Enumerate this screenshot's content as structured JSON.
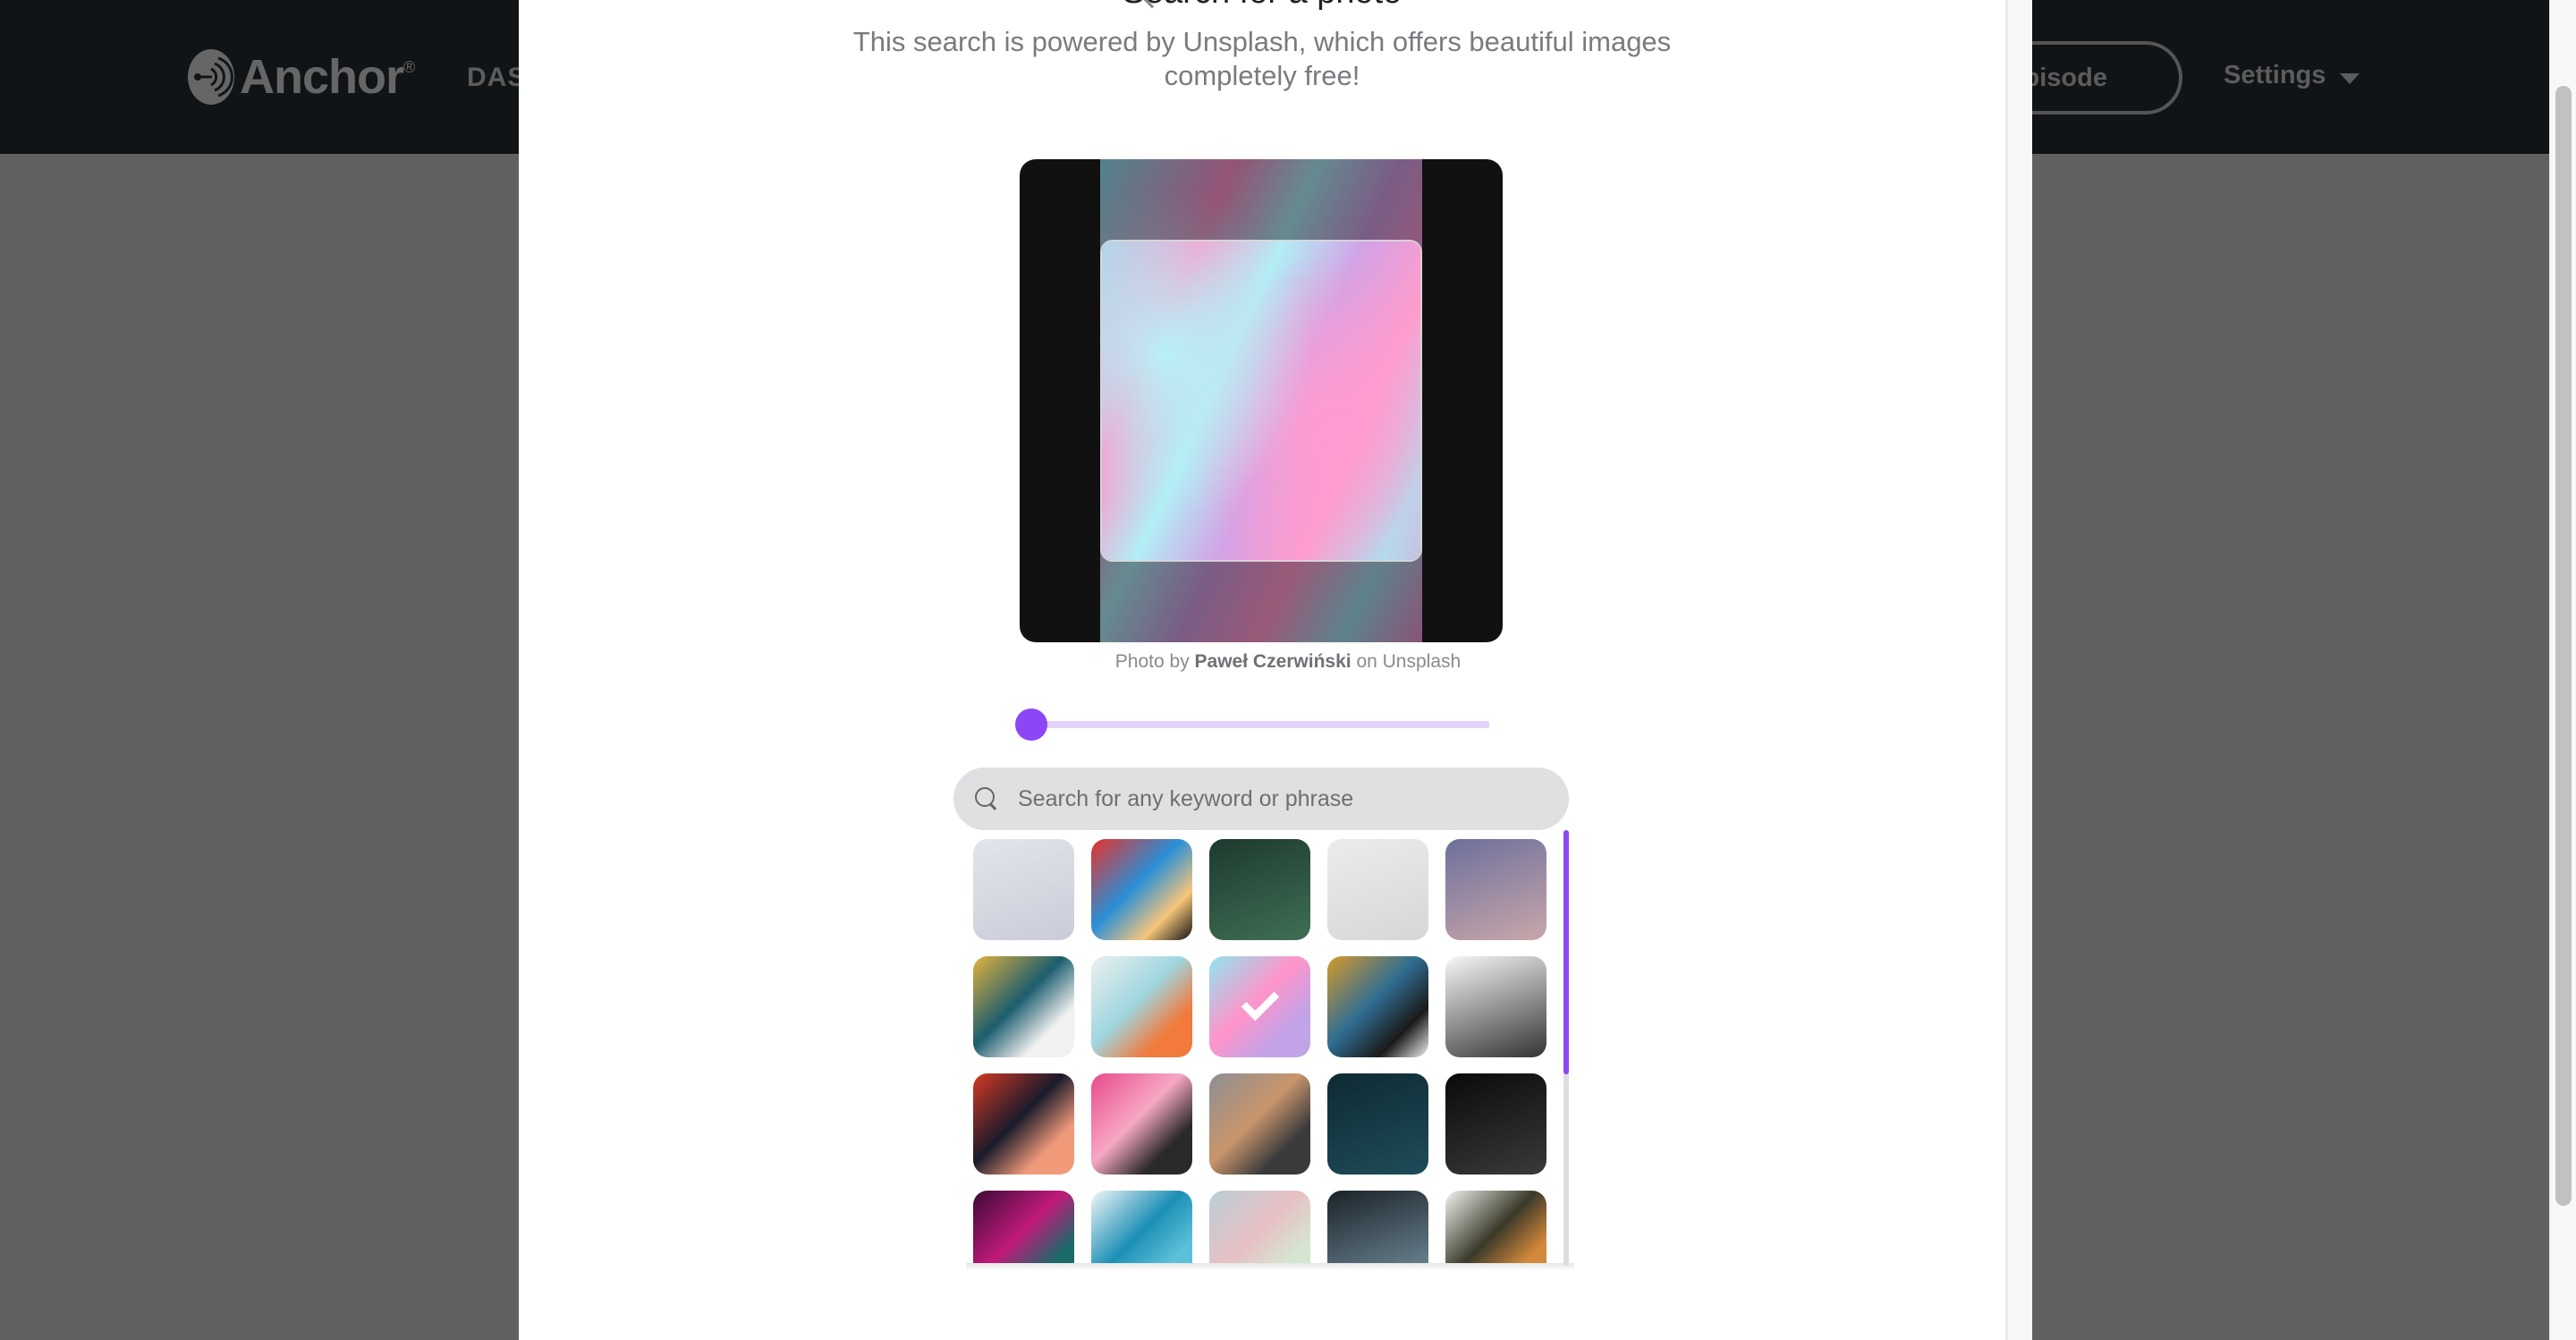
{
  "app": {
    "brand": "Anchor",
    "brand_mark": "®"
  },
  "topbar": {
    "nav_partial": "DAS",
    "episode_button_partial": "pisode",
    "settings_label": "Settings"
  },
  "modal": {
    "title": "Search for a photo",
    "subtitle_line1": "This search is powered by Unsplash, which offers beautiful images",
    "subtitle_line2": "completely free!",
    "caption": {
      "prefix": "Photo by ",
      "author": "Paweł Czerwiński",
      "suffix": " on Unsplash"
    },
    "zoom_slider": {
      "value_fraction": 0.0
    },
    "search": {
      "value": "",
      "placeholder": "Search for any keyword or phrase"
    },
    "results_scroll": {
      "visible_fraction": 0.56,
      "position_fraction": 0.0
    },
    "thumbnails": [
      {
        "name": "white-waves",
        "selected": false,
        "colors": [
          "#e3e5ec",
          "#c9ccd8"
        ]
      },
      {
        "name": "colorful-bricks",
        "selected": false,
        "colors": [
          "#e8312b",
          "#2a8fd6",
          "#f5c57a",
          "#111111"
        ]
      },
      {
        "name": "green-leaves",
        "selected": false,
        "colors": [
          "#1d3a2e",
          "#3f6f55"
        ]
      },
      {
        "name": "white-texture",
        "selected": false,
        "colors": [
          "#ececec",
          "#d6d6d6"
        ]
      },
      {
        "name": "purple-scales",
        "selected": false,
        "colors": [
          "#6d6f9c",
          "#c9a7aa"
        ]
      },
      {
        "name": "yellow-tiles",
        "selected": false,
        "colors": [
          "#e3b23c",
          "#1c5d6e",
          "#f1f1f1"
        ]
      },
      {
        "name": "pastel-paint",
        "selected": false,
        "colors": [
          "#eef0ee",
          "#9fd6e0",
          "#f27a3c"
        ]
      },
      {
        "name": "pink-blue-marble",
        "selected": true,
        "colors": [
          "#8fe6f2",
          "#ff94c9",
          "#c2a3e8"
        ]
      },
      {
        "name": "geometric-triangles",
        "selected": false,
        "colors": [
          "#d69a2a",
          "#2f6d92",
          "#1a1a1a",
          "#8a1f1f",
          "#f2f2f2"
        ]
      },
      {
        "name": "line-pattern",
        "selected": false,
        "colors": [
          "#f7f7f7",
          "#333333"
        ]
      },
      {
        "name": "red-swirls",
        "selected": false,
        "colors": [
          "#d63a24",
          "#1a1a2a",
          "#f09a7a"
        ]
      },
      {
        "name": "pink-flowers",
        "selected": false,
        "colors": [
          "#e84a8c",
          "#f7a7c4",
          "#2a2a2a"
        ]
      },
      {
        "name": "metal-pyramids",
        "selected": false,
        "colors": [
          "#8d8f94",
          "#c9956c",
          "#3a3a3c"
        ]
      },
      {
        "name": "dark-teal-marble",
        "selected": false,
        "colors": [
          "#0e2a33",
          "#1e4c59"
        ]
      },
      {
        "name": "black-chevrons",
        "selected": false,
        "colors": [
          "#0a0a0a",
          "#3a3a3a"
        ]
      },
      {
        "name": "purple-fur",
        "selected": false,
        "colors": [
          "#3a0a36",
          "#c01a7a",
          "#1a6a6a"
        ]
      },
      {
        "name": "blue-blossoms",
        "selected": false,
        "colors": [
          "#f2f6f7",
          "#1c8fb6",
          "#5cc1d8"
        ]
      },
      {
        "name": "pastel-scales",
        "selected": false,
        "colors": [
          "#b9cfd6",
          "#e8c0c4",
          "#d4e6d0"
        ]
      },
      {
        "name": "frosted-glass",
        "selected": false,
        "colors": [
          "#1a2228",
          "#7a96a6"
        ]
      },
      {
        "name": "floral-vines",
        "selected": false,
        "colors": [
          "#f4f4f2",
          "#3a3a2a",
          "#d4883a"
        ]
      }
    ]
  },
  "colors": {
    "accent": "#8c46f5",
    "accent_light": "#e2d2fb",
    "topbar": "#111417",
    "backdrop": "#616161"
  }
}
